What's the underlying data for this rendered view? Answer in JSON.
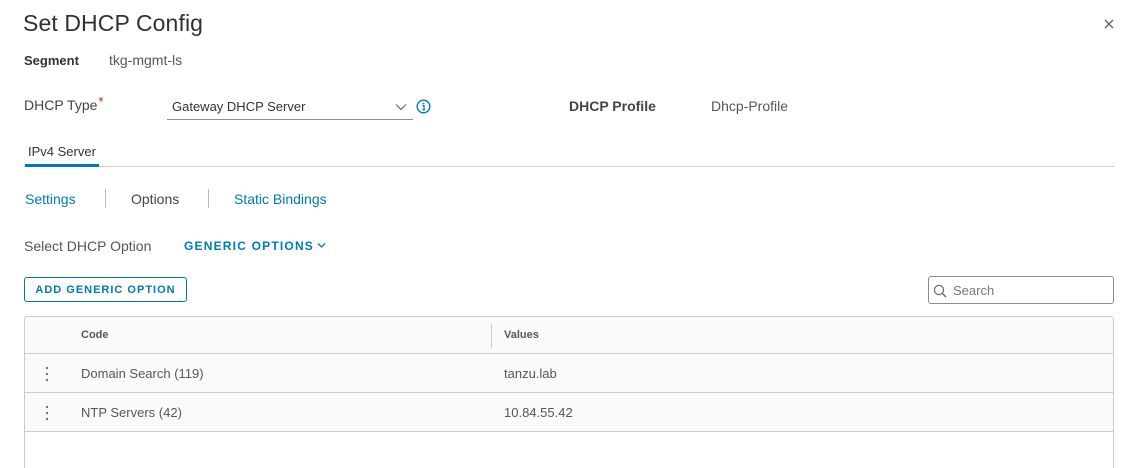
{
  "dialog": {
    "title": "Set DHCP Config",
    "close_icon": "close-icon"
  },
  "segment": {
    "label": "Segment",
    "value": "tkg-mgmt-ls"
  },
  "dhcp_type": {
    "label": "DHCP Type",
    "required_mark": "*",
    "selected": "Gateway DHCP Server",
    "info_icon": "info-icon"
  },
  "dhcp_profile": {
    "label": "DHCP Profile",
    "value": "Dhcp-Profile"
  },
  "tabs": [
    {
      "label": "IPv4 Server",
      "active": true
    }
  ],
  "subnav": [
    {
      "label": "Settings",
      "active": false
    },
    {
      "label": "Options",
      "active": true
    },
    {
      "label": "Static Bindings",
      "active": false
    }
  ],
  "option_select": {
    "label": "Select DHCP Option",
    "value": "GENERIC OPTIONS"
  },
  "toolbar": {
    "add_label": "ADD GENERIC OPTION",
    "search_placeholder": "Search"
  },
  "table": {
    "columns": [
      "Code",
      "Values"
    ],
    "rows": [
      {
        "code": "Domain Search (119)",
        "value": "tanzu.lab"
      },
      {
        "code": "NTP Servers (42)",
        "value": "10.84.55.42"
      }
    ]
  },
  "colors": {
    "accent": "#0079b8",
    "required": "#c21d00"
  }
}
